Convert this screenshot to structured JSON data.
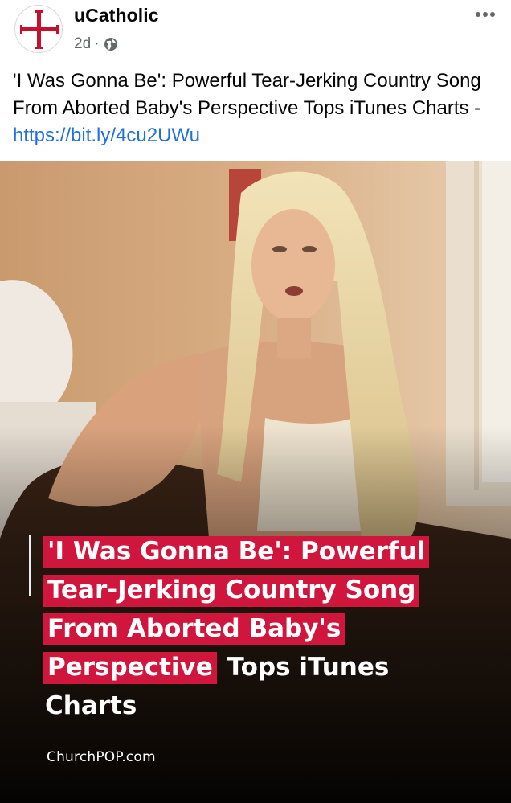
{
  "post": {
    "page_name": "uCatholic",
    "timestamp": "2d",
    "separator": "·",
    "text": "'I Was Gonna Be': Powerful Tear-Jerking Country Song From Aborted Baby's Perspective Tops iTunes Charts - ",
    "link": "https://bit.ly/4cu2UWu"
  },
  "media": {
    "headline": {
      "line1": "'I Was Gonna Be': Powerful",
      "line2": "Tear-Jerking Country Song",
      "line3": "From Aborted Baby's",
      "line4_highlight": "Perspective",
      "line4_plain": "Tops iTunes",
      "line5": "Charts"
    },
    "source": "ChurchPOP.com"
  },
  "colors": {
    "link": "#216fdb",
    "highlight": "#d0163c",
    "cross": "#c8102e",
    "meta": "#65676b"
  },
  "icons": {
    "avatar": "red-cross-icon",
    "audience": "globe-icon",
    "menu": "more-dots-icon"
  }
}
